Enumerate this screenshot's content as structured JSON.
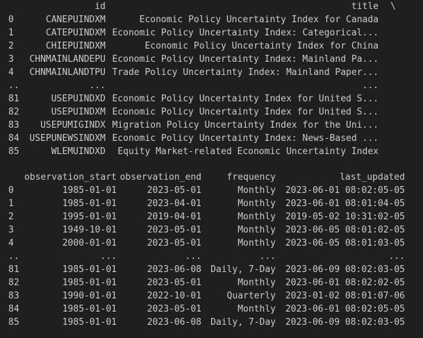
{
  "table1": {
    "columns": {
      "id": "id",
      "title": "title",
      "continuation": "\\"
    },
    "rows": [
      {
        "index": "0",
        "id": "CANEPUINDXM",
        "title": "Economic Policy Uncertainty Index for Canada"
      },
      {
        "index": "1",
        "id": "CATEPUINDXM",
        "title": "Economic Policy Uncertainty Index: Categorical..."
      },
      {
        "index": "2",
        "id": "CHIEPUINDXM",
        "title": "Economic Policy Uncertainty Index for China"
      },
      {
        "index": "3",
        "id": "CHNMAINLANDEPU",
        "title": "Economic Policy Uncertainty Index: Mainland Pa..."
      },
      {
        "index": "4",
        "id": "CHNMAINLANDTPU",
        "title": "Trade Policy Uncertainty Index: Mainland Paper..."
      },
      {
        "index": "..",
        "id": "...",
        "title": "..."
      },
      {
        "index": "81",
        "id": "USEPUINDXD",
        "title": "Economic Policy Uncertainty Index for United S..."
      },
      {
        "index": "82",
        "id": "USEPUINDXM",
        "title": "Economic Policy Uncertainty Index for United S..."
      },
      {
        "index": "83",
        "id": "USEPUMIGINDX",
        "title": "Migration Policy Uncertainty Index for the Uni..."
      },
      {
        "index": "84",
        "id": "USEPUNEWSINDXM",
        "title": "Economic Policy Uncertainty Index: News-Based ..."
      },
      {
        "index": "85",
        "id": "WLEMUINDXD",
        "title": "Equity Market-related Economic Uncertainty Index"
      }
    ]
  },
  "table2": {
    "columns": {
      "observation_start": "observation_start",
      "observation_end": "observation_end",
      "frequency": "frequency",
      "last_updated": "last_updated"
    },
    "rows": [
      {
        "index": "0",
        "start": "1985-01-01",
        "end": "2023-05-01",
        "freq": "Monthly",
        "updated": "2023-06-01 08:02:05-05"
      },
      {
        "index": "1",
        "start": "1985-01-01",
        "end": "2023-04-01",
        "freq": "Monthly",
        "updated": "2023-06-01 08:01:04-05"
      },
      {
        "index": "2",
        "start": "1995-01-01",
        "end": "2019-04-01",
        "freq": "Monthly",
        "updated": "2019-05-02 10:31:02-05"
      },
      {
        "index": "3",
        "start": "1949-10-01",
        "end": "2023-05-01",
        "freq": "Monthly",
        "updated": "2023-06-05 08:01:02-05"
      },
      {
        "index": "4",
        "start": "2000-01-01",
        "end": "2023-05-01",
        "freq": "Monthly",
        "updated": "2023-06-05 08:01:03-05"
      },
      {
        "index": "..",
        "start": "...",
        "end": "...",
        "freq": "...",
        "updated": "..."
      },
      {
        "index": "81",
        "start": "1985-01-01",
        "end": "2023-06-08",
        "freq": "Daily, 7-Day",
        "updated": "2023-06-09 08:02:03-05"
      },
      {
        "index": "82",
        "start": "1985-01-01",
        "end": "2023-05-01",
        "freq": "Monthly",
        "updated": "2023-06-01 08:02:02-05"
      },
      {
        "index": "83",
        "start": "1990-01-01",
        "end": "2022-10-01",
        "freq": "Quarterly",
        "updated": "2023-01-02 08:01:07-06"
      },
      {
        "index": "84",
        "start": "1985-01-01",
        "end": "2023-05-01",
        "freq": "Monthly",
        "updated": "2023-06-01 08:02:05-05"
      },
      {
        "index": "85",
        "start": "1985-01-01",
        "end": "2023-06-08",
        "freq": "Daily, 7-Day",
        "updated": "2023-06-09 08:02:03-05"
      }
    ]
  }
}
